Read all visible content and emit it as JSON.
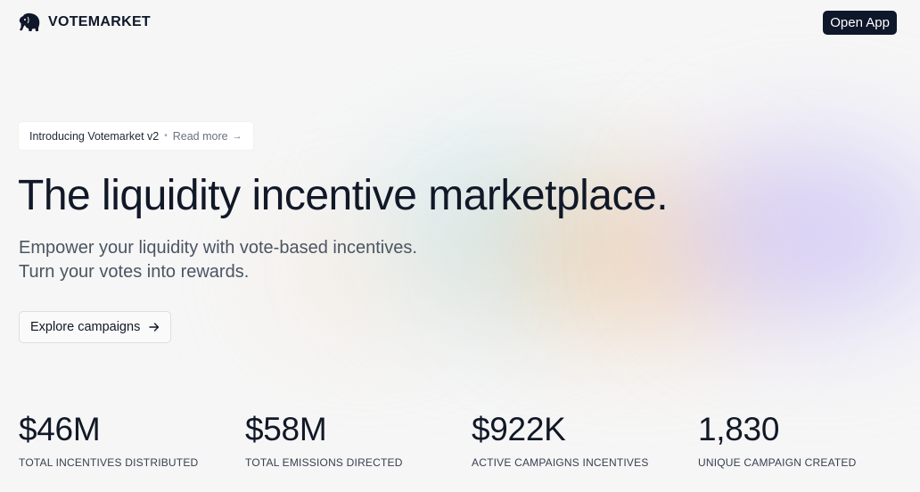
{
  "header": {
    "brand": "VOTEMARKET",
    "logo_icon": "elephant-icon",
    "open_app_label": "Open App"
  },
  "announcement": {
    "intro": "Introducing Votemarket v2",
    "separator": "•",
    "read_more": "Read more",
    "arrow": "→"
  },
  "hero": {
    "title": "The liquidity incentive marketplace.",
    "subtitle_line1": "Empower your liquidity with vote-based incentives.",
    "subtitle_line2": "Turn your votes into rewards.",
    "cta_label": "Explore campaigns",
    "cta_icon": "arrow-right-icon"
  },
  "stats": [
    {
      "value": "$46M",
      "label": "TOTAL INCENTIVES DISTRIBUTED"
    },
    {
      "value": "$58M",
      "label": "TOTAL EMISSIONS DIRECTED"
    },
    {
      "value": "$922K",
      "label": "ACTIVE CAMPAIGNS INCENTIVES"
    },
    {
      "value": "1,830",
      "label": "UNIQUE CAMPAIGN CREATED"
    }
  ],
  "colors": {
    "background": "#f6f6f6",
    "primary_button": "#0f172a",
    "text": "#111827",
    "muted_text": "#4b5563"
  }
}
